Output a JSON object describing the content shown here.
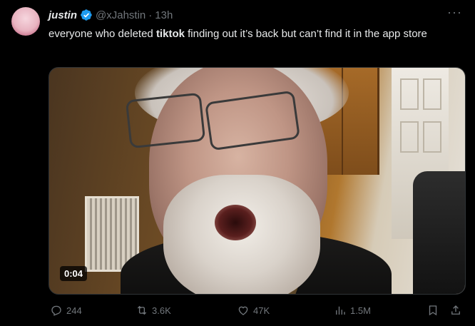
{
  "author": {
    "name": "justin",
    "handle": "@xJahstin",
    "separator": "·",
    "time": "13h"
  },
  "tweet": {
    "text_before": "everyone who deleted ",
    "text_bold": "tiktok",
    "text_after": " finding out it’s back but can’t find it in the app store"
  },
  "media": {
    "duration": "0:04"
  },
  "actions": {
    "replies": "244",
    "reposts": "3.6K",
    "likes": "47K",
    "views": "1.5M"
  },
  "colors": {
    "background": "#000000",
    "text": "#e7e9ea",
    "muted": "#71767b",
    "verified": "#1d9bf0"
  },
  "icons": [
    "more-icon",
    "verified-icon",
    "reply-icon",
    "repost-icon",
    "like-icon",
    "views-icon",
    "bookmark-icon",
    "share-icon"
  ]
}
